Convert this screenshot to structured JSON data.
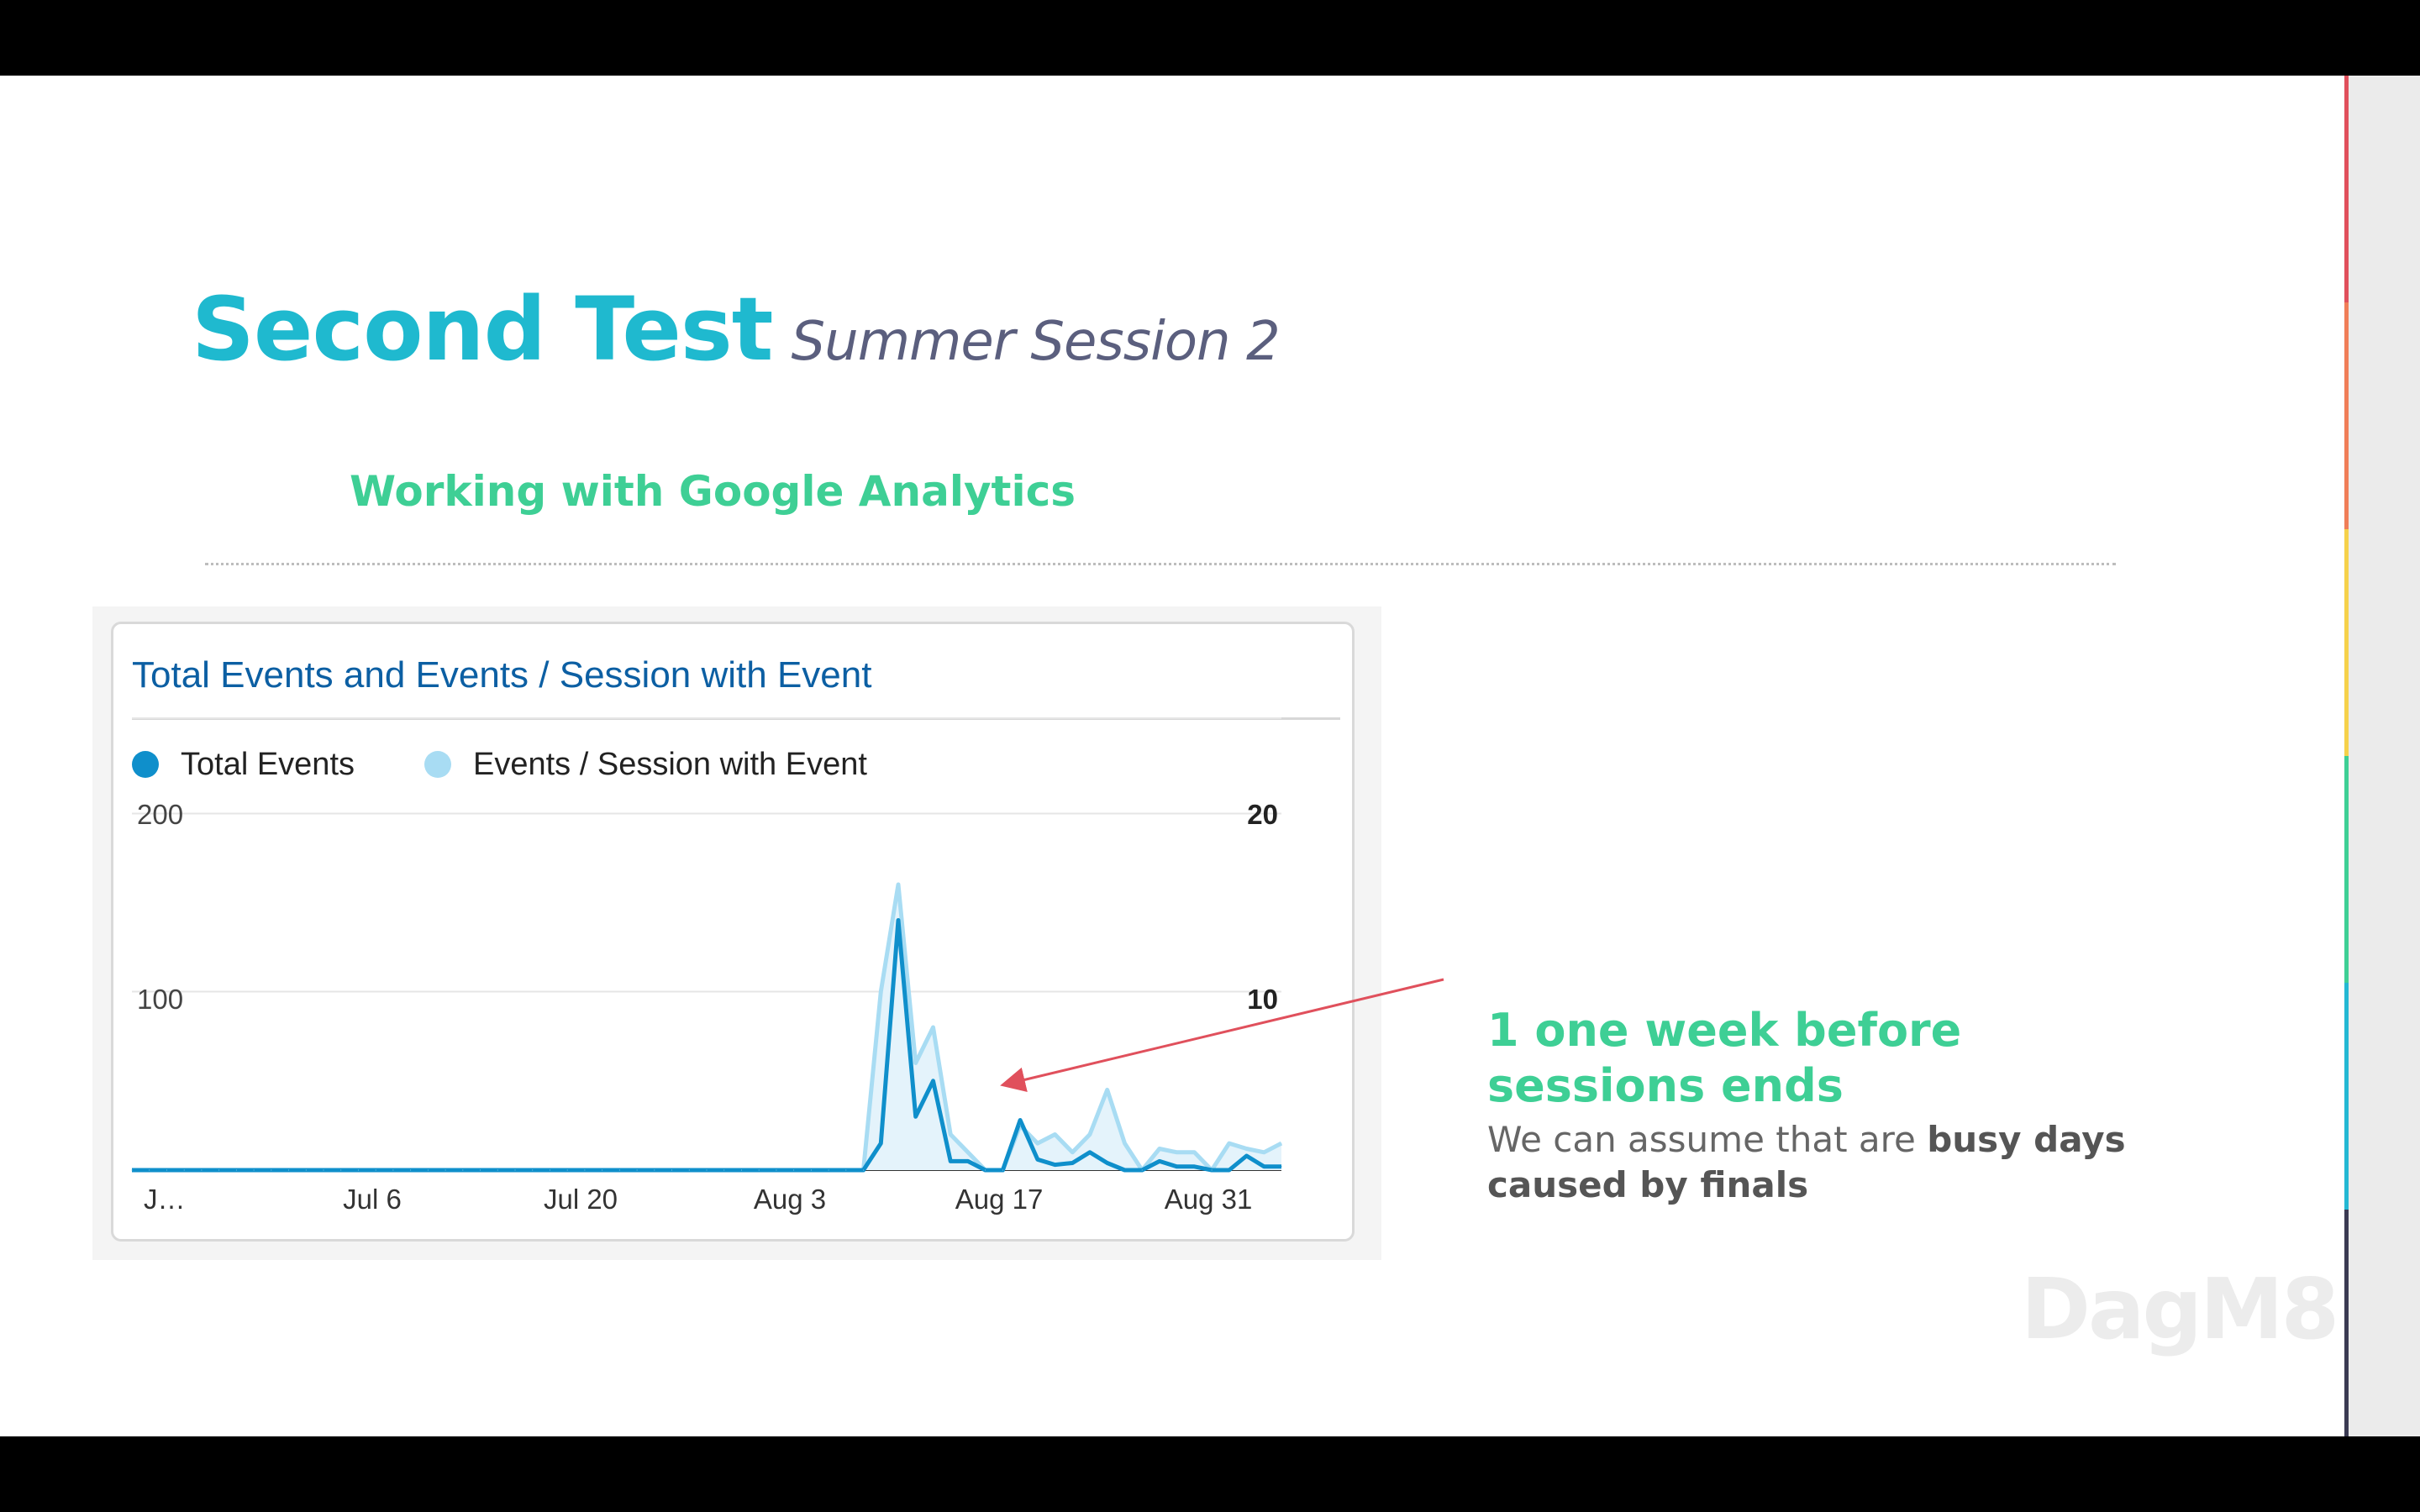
{
  "slide": {
    "title": "Second Test",
    "title_italic": "Summer Session 2",
    "subtitle": "Working with Google Analytics",
    "logo": "DagM8",
    "stripe_colors": [
      "#e0505c",
      "#f07e58",
      "#f5d14b",
      "#3ecf95",
      "#24b8d3",
      "#3a3a52"
    ],
    "title_color": "#1fb9cf",
    "accent_green": "#3ecf95"
  },
  "chart": {
    "title": "Total Events and Events / Session with Event",
    "legend": [
      {
        "label": "Total Events",
        "color": "#0f8fcb"
      },
      {
        "label": "Events / Session with Event",
        "color": "#a8dcf3"
      }
    ],
    "y_left_ticks": [
      "200",
      "100"
    ],
    "y_right_ticks": [
      "20",
      "10"
    ],
    "x_ticks": [
      "J…",
      "Jul 6",
      "Jul 20",
      "Aug 3",
      "Aug 17",
      "Aug 31"
    ]
  },
  "chart_data": {
    "type": "line",
    "title": "Total Events and Events / Session with Event",
    "x": [
      "Jul 1",
      "Jul 2",
      "Jul 3",
      "Jul 4",
      "Jul 5",
      "Jul 6",
      "Jul 7",
      "Jul 8",
      "Jul 9",
      "Jul 10",
      "Jul 11",
      "Jul 12",
      "Jul 13",
      "Jul 14",
      "Jul 15",
      "Jul 16",
      "Jul 17",
      "Jul 18",
      "Jul 19",
      "Jul 20",
      "Jul 21",
      "Jul 22",
      "Jul 23",
      "Jul 24",
      "Jul 25",
      "Jul 26",
      "Jul 27",
      "Jul 28",
      "Jul 29",
      "Jul 30",
      "Jul 31",
      "Aug 1",
      "Aug 2",
      "Aug 3",
      "Aug 4",
      "Aug 5",
      "Aug 6",
      "Aug 7",
      "Aug 8",
      "Aug 9",
      "Aug 10",
      "Aug 11",
      "Aug 12",
      "Aug 13",
      "Aug 14",
      "Aug 15",
      "Aug 16",
      "Aug 17",
      "Aug 18",
      "Aug 19",
      "Aug 20",
      "Aug 21",
      "Aug 22",
      "Aug 23",
      "Aug 24",
      "Aug 25",
      "Aug 26",
      "Aug 27",
      "Aug 28",
      "Aug 29",
      "Aug 30",
      "Aug 31",
      "Sep 1",
      "Sep 2",
      "Sep 3",
      "Sep 4",
      "Sep 5"
    ],
    "series": [
      {
        "name": "Total Events",
        "axis": "left",
        "values": [
          0,
          0,
          0,
          0,
          0,
          0,
          0,
          0,
          0,
          0,
          0,
          0,
          0,
          0,
          0,
          0,
          0,
          0,
          0,
          0,
          0,
          0,
          0,
          0,
          0,
          0,
          0,
          0,
          0,
          0,
          0,
          0,
          0,
          0,
          0,
          0,
          0,
          0,
          0,
          0,
          0,
          0,
          0,
          15,
          140,
          30,
          50,
          5,
          5,
          0,
          0,
          28,
          6,
          3,
          4,
          10,
          4,
          0,
          0,
          5,
          2,
          2,
          0,
          0,
          8,
          2,
          2,
          3,
          2,
          0
        ]
      },
      {
        "name": "Events / Session with Event",
        "axis": "right",
        "values": [
          0,
          0,
          0,
          0,
          0,
          0,
          0,
          0,
          0,
          0,
          0,
          0,
          0,
          0,
          0,
          0,
          0,
          0,
          0,
          0,
          0,
          0,
          0,
          0,
          0,
          0,
          0,
          0,
          0,
          0,
          0,
          0,
          0,
          0,
          0,
          0,
          0,
          0,
          0,
          0,
          0,
          0,
          0,
          10,
          16,
          6,
          8,
          2,
          1,
          0,
          0,
          2.5,
          1.5,
          2,
          1,
          2,
          4.5,
          1.5,
          0,
          1.2,
          1,
          1,
          0,
          1.5,
          1.2,
          1,
          1.5,
          0.8,
          0
        ]
      }
    ],
    "y_left_lim": [
      0,
      200
    ],
    "y_right_lim": [
      0,
      20
    ],
    "grid": true,
    "legend_position": "top-left"
  },
  "annotation": {
    "heading": "1 one week before sessions ends",
    "body_prefix": "We can assume that are ",
    "body_bold": "busy days caused by finals"
  }
}
